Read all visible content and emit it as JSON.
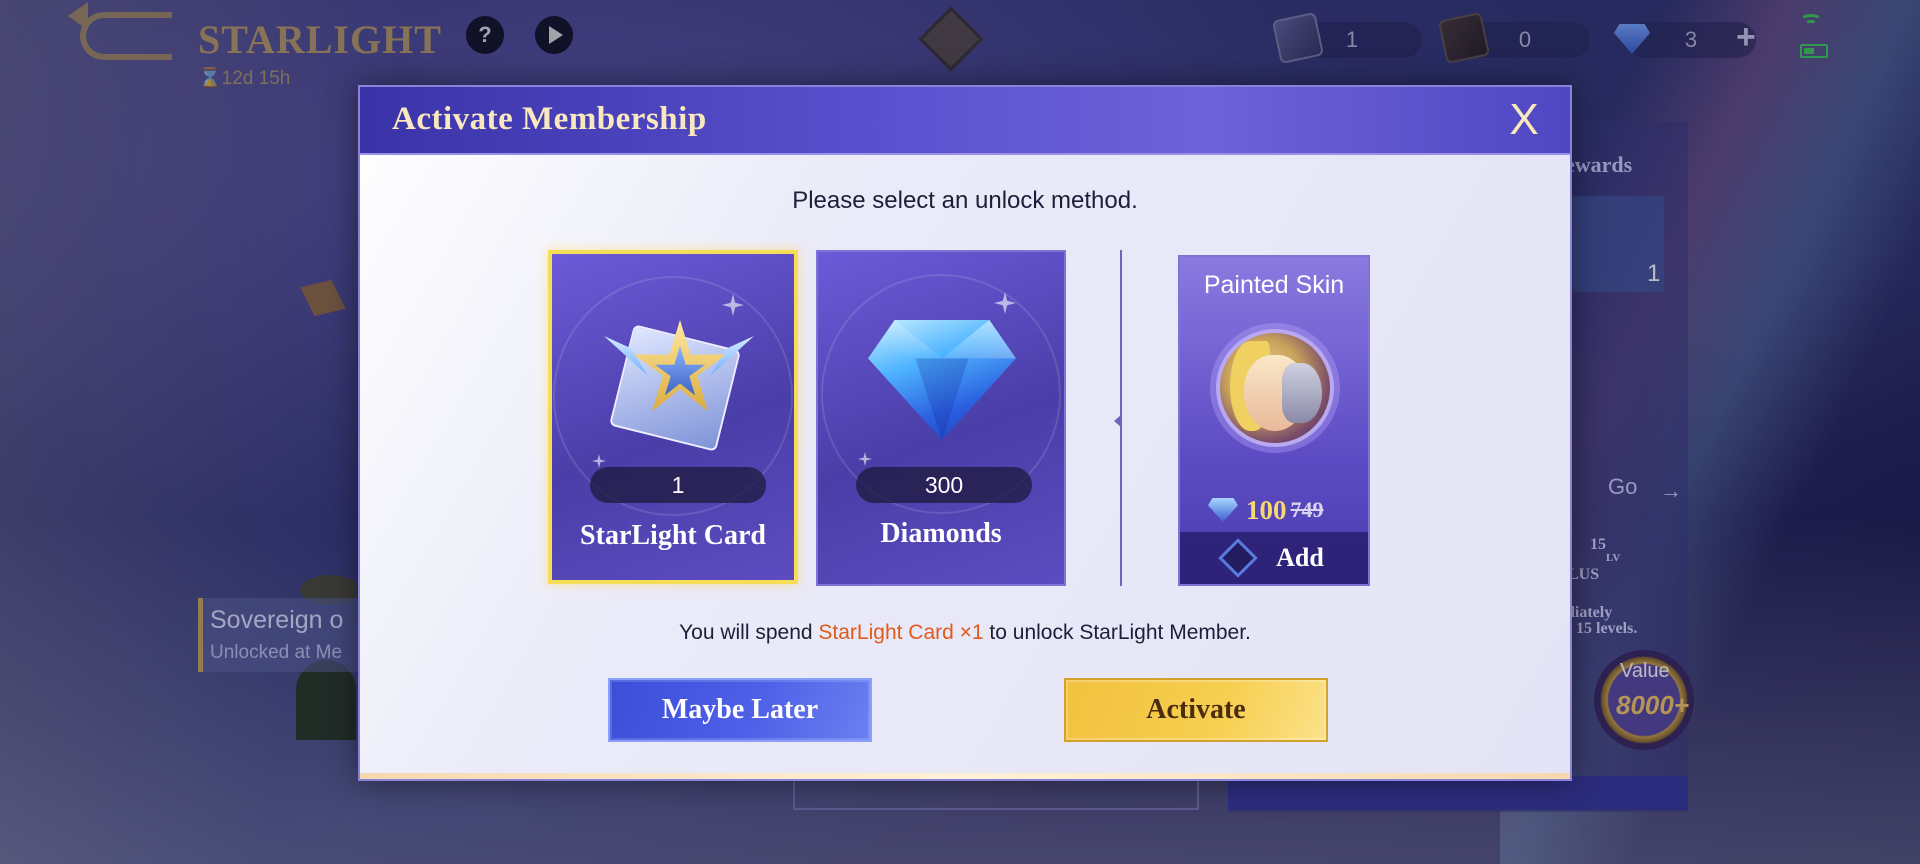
{
  "topbar": {
    "title": "STARLIGHT",
    "timer": "⌛12d 15h",
    "help_glyph": "?",
    "currencies": [
      {
        "icon": "ticket-icon",
        "value": "1"
      },
      {
        "icon": "dark-ticket-icon",
        "value": "0"
      },
      {
        "icon": "diamond-icon",
        "value": "3"
      }
    ],
    "add_glyph": "+"
  },
  "background": {
    "rewards_label": "ewards",
    "reward_count": "1",
    "go_label": "Go",
    "badge_level": "15",
    "badge_level_unit": "LV",
    "badge_tag": "LUS",
    "note_line1": "diately",
    "note_line2": "15 levels.",
    "value_label": "Value",
    "value_amount": "8000+",
    "sovereign_title": "Sovereign o",
    "sovereign_sub": "Unlocked at Me"
  },
  "modal": {
    "title": "Activate Membership",
    "close_label": "X",
    "prompt": "Please select an unlock method.",
    "options": [
      {
        "label": "StarLight Card",
        "count": "1",
        "selected": true
      },
      {
        "label": "Diamonds",
        "count": "300",
        "selected": false
      }
    ],
    "skin": {
      "title": "Painted Skin",
      "price": "100",
      "old_price": "749",
      "add_label": "Add"
    },
    "spend": {
      "prefix": "You will spend ",
      "highlight": "StarLight Card ×1",
      "suffix": " to unlock StarLight Member."
    },
    "buttons": {
      "later": "Maybe Later",
      "activate": "Activate"
    }
  },
  "colors": {
    "selected_border": "#f6dd58",
    "highlight_text": "#e05a1a",
    "header_gradient_start": "#3a33a8",
    "title_gold": "#f9e7bd"
  }
}
